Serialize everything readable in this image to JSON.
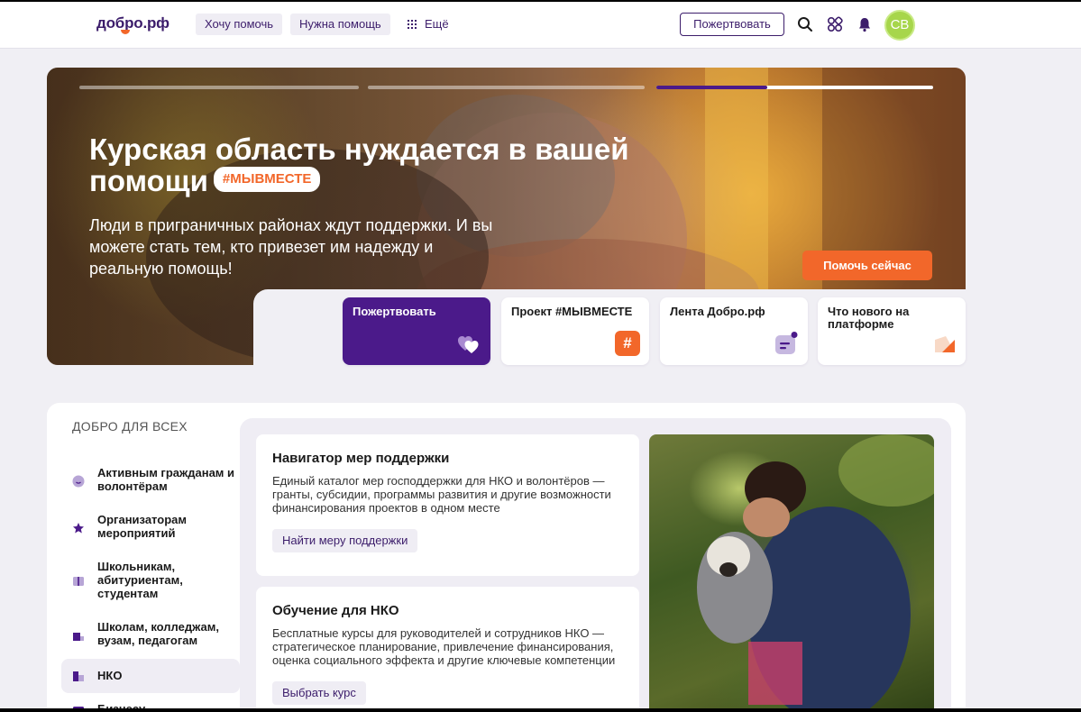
{
  "header": {
    "logo": "добро.рф",
    "nav": [
      "Хочу помочь",
      "Нужна помощь"
    ],
    "more_label": "Ещё",
    "donate_label": "Пожертвовать",
    "avatar_initials": "СВ"
  },
  "hero": {
    "title": "Курская область нуждается в вашей помощи",
    "tag": "#МЫВМЕСТЕ",
    "subtitle": "Люди в приграничных районах ждут поддержки. И вы можете стать тем, кто привезет им надежду и реальную помощь!",
    "cta": "Помочь сейчас",
    "slides": {
      "count": 3,
      "active_index": 2,
      "active_progress": 0.4
    }
  },
  "quick_cards": [
    {
      "label": "Пожертвовать",
      "icon": "hearts-icon"
    },
    {
      "label": "Проект #МЫВМЕСТЕ",
      "icon": "hashtag-icon"
    },
    {
      "label": "Лента Добро.рф",
      "icon": "feed-icon"
    },
    {
      "label": "Что нового на платформе",
      "icon": "megaphone-icon"
    }
  ],
  "section": {
    "title": "ДОБРО ДЛЯ ВСЕХ",
    "sidebar": [
      {
        "label": "Активным гражданам и волонтёрам",
        "icon": "smile-icon"
      },
      {
        "label": "Организаторам мероприятий",
        "icon": "star-icon"
      },
      {
        "label": "Школьникам, абитуриентам, студентам",
        "icon": "book-icon"
      },
      {
        "label": "Школам, колледжам, вузам, педагогам",
        "icon": "school-icon"
      },
      {
        "label": "НКО",
        "icon": "building-icon"
      },
      {
        "label": "Бизнесу",
        "icon": "briefcase-icon"
      }
    ],
    "active_item": "НКО",
    "cards": [
      {
        "title": "Навигатор мер поддержки",
        "text": "Единый каталог мер господдержки для НКО и волонтёров — гранты, субсидии, программы развития и другие возможности финансирования проектов в одном месте",
        "button": "Найти меру поддержки"
      },
      {
        "title": "Обучение для НКО",
        "text": "Бесплатные курсы для руководителей и сотрудников НКО — стратегическое планирование, привлечение финансирования, оценка социального эффекта и другие ключевые компетенции",
        "button": "Выбрать курс"
      }
    ]
  },
  "colors": {
    "brand_purple": "#4b1a8a",
    "brand_dark": "#3c1d6b",
    "accent_orange": "#f2672a",
    "avatar_green": "#a7d64b"
  }
}
